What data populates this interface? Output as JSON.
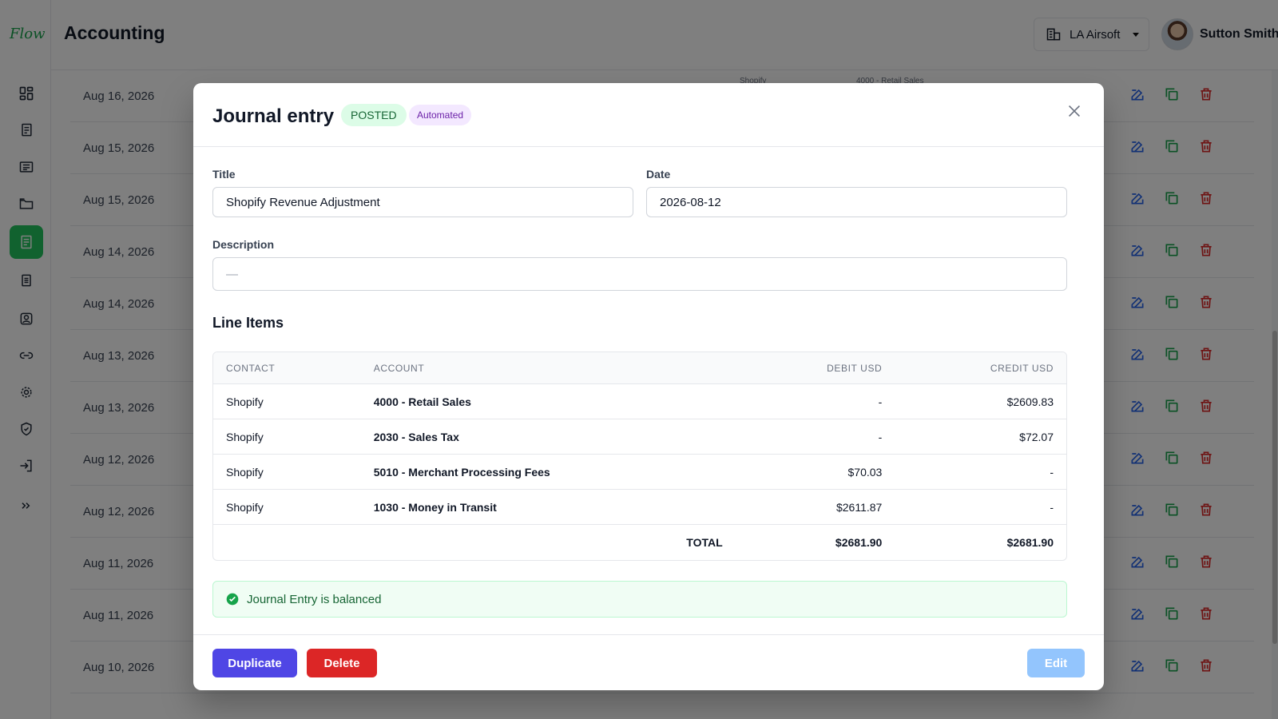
{
  "app": {
    "logo": "Flow",
    "title": "Accounting",
    "organization": "LA Airsoft",
    "user_name": "Sutton Smith"
  },
  "sidebar": {
    "items": [
      {
        "icon": "dashboard-icon"
      },
      {
        "icon": "invoices-icon"
      },
      {
        "icon": "statements-icon"
      },
      {
        "icon": "folder-icon"
      },
      {
        "icon": "journal-icon",
        "active": true
      },
      {
        "icon": "reports-icon"
      },
      {
        "icon": "contacts-icon"
      },
      {
        "icon": "link-icon"
      },
      {
        "icon": "settings-icon"
      },
      {
        "icon": "shield-icon"
      },
      {
        "icon": "logout-icon"
      },
      {
        "icon": "expand-icon"
      }
    ]
  },
  "background_rows": [
    {
      "date": "Aug 16, 2026"
    },
    {
      "date": "Aug 15, 2026"
    },
    {
      "date": "Aug 15, 2026"
    },
    {
      "date": "Aug 14, 2026"
    },
    {
      "date": "Aug 14, 2026"
    },
    {
      "date": "Aug 13, 2026"
    },
    {
      "date": "Aug 13, 2026"
    },
    {
      "date": "Aug 12, 2026"
    },
    {
      "date": "Aug 12, 2026"
    },
    {
      "date": "Aug 11, 2026"
    },
    {
      "date": "Aug 11, 2026"
    },
    {
      "date": "Aug 10, 2026"
    }
  ],
  "background_peek": {
    "contact": "Shopify",
    "account": "4000 - Retail Sales"
  },
  "modal": {
    "title": "Journal entry",
    "status_badge": "POSTED",
    "type_badge": "Automated",
    "fields": {
      "title_label": "Title",
      "title_value": "Shopify Revenue Adjustment",
      "date_label": "Date",
      "date_value": "2026-08-12",
      "description_label": "Description",
      "description_value": "—"
    },
    "line_items_title": "Line Items",
    "columns": {
      "contact": "CONTACT",
      "account": "ACCOUNT",
      "debit": "DEBIT USD",
      "credit": "CREDIT USD"
    },
    "lines": [
      {
        "contact": "Shopify",
        "account": "4000 - Retail Sales",
        "debit": "-",
        "credit": "$2609.83"
      },
      {
        "contact": "Shopify",
        "account": "2030 - Sales Tax",
        "debit": "-",
        "credit": "$72.07"
      },
      {
        "contact": "Shopify",
        "account": "5010 - Merchant Processing Fees",
        "debit": "$70.03",
        "credit": "-"
      },
      {
        "contact": "Shopify",
        "account": "1030 - Money in Transit",
        "debit": "$2611.87",
        "credit": "-"
      }
    ],
    "totals": {
      "label": "TOTAL",
      "debit": "$2681.90",
      "credit": "$2681.90"
    },
    "balance_message": "Journal Entry is balanced",
    "buttons": {
      "duplicate": "Duplicate",
      "delete": "Delete",
      "edit": "Edit"
    }
  },
  "colors": {
    "primary": "#4f46e5",
    "danger": "#dc2626",
    "success": "#16a34a",
    "edit_disabled": "#93c5fd"
  }
}
